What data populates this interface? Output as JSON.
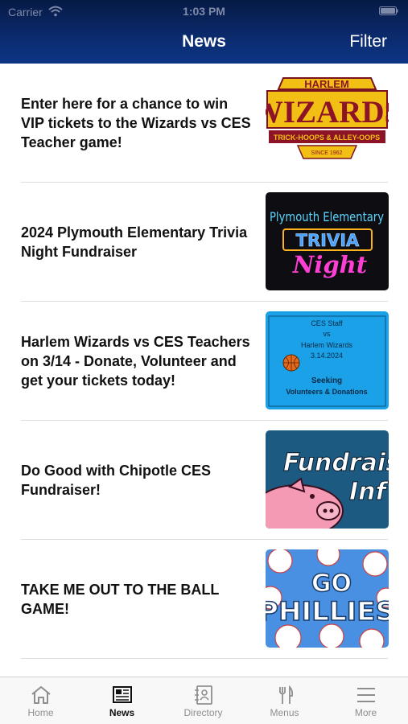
{
  "status_bar": {
    "carrier": "Carrier",
    "time": "1:03 PM"
  },
  "header": {
    "title": "News",
    "filter_label": "Filter"
  },
  "news": [
    {
      "title": "Enter here for a chance to win VIP tickets to the Wizards vs CES Teacher game!",
      "image": {
        "line1": "HARLEM",
        "line2": "WIZARDS",
        "line3": "TRICK-HOOPS & ALLEY-OOPS",
        "line4": "SINCE 1962"
      }
    },
    {
      "title": "2024 Plymouth Elementary Trivia Night Fundraiser",
      "image": {
        "line1": "Plymouth Elementary",
        "line2": "TRIVIA",
        "line3": "Night"
      }
    },
    {
      "title": "Harlem Wizards vs CES Teachers on 3/14 - Donate, Volunteer and get your tickets today!",
      "image": {
        "line1": "CES Staff",
        "line2": "vs",
        "line3": "Harlem Wizards",
        "line4": "3.14.2024",
        "line5": "Seeking",
        "line6": "Volunteers & Donations"
      }
    },
    {
      "title": "Do Good with Chipotle CES Fundraiser!",
      "image": {
        "line1": "Fundraise",
        "line2": "Inf"
      }
    },
    {
      "title": "TAKE ME OUT TO THE BALL GAME!",
      "image": {
        "line1": "GO",
        "line2": "PHILLIES"
      }
    }
  ],
  "tabs": [
    {
      "label": "Home",
      "icon": "home-icon",
      "active": false
    },
    {
      "label": "News",
      "icon": "news-icon",
      "active": true
    },
    {
      "label": "Directory",
      "icon": "directory-icon",
      "active": false
    },
    {
      "label": "Menus",
      "icon": "menus-icon",
      "active": false
    },
    {
      "label": "More",
      "icon": "more-icon",
      "active": false
    }
  ],
  "colors": {
    "header": "#0b2a6b",
    "tab_active": "#111111",
    "tab_inactive": "#8e8e8e"
  }
}
